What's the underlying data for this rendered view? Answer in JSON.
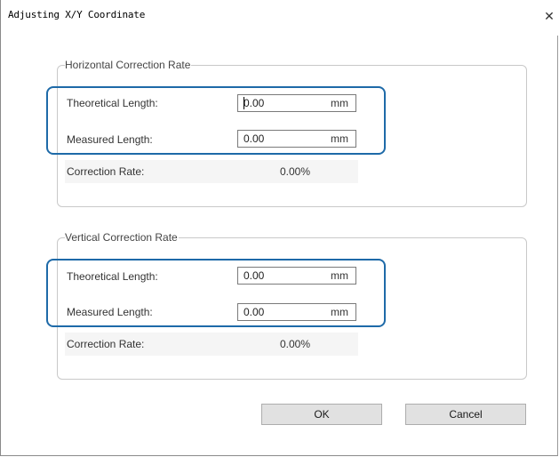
{
  "window": {
    "title": "Adjusting X/Y Coordinate",
    "close_glyph": "✕"
  },
  "horizontal": {
    "legend": "Horizontal Correction Rate",
    "theoretical_label": "Theoretical Length:",
    "theoretical_value": "0.00",
    "theoretical_unit": "mm",
    "measured_label": "Measured Length:",
    "measured_value": "0.00",
    "measured_unit": "mm",
    "rate_label": "Correction Rate:",
    "rate_value": "0.00%"
  },
  "vertical": {
    "legend": "Vertical Correction Rate",
    "theoretical_label": "Theoretical Length:",
    "theoretical_value": "0.00",
    "theoretical_unit": "mm",
    "measured_label": "Measured Length:",
    "measured_value": "0.00",
    "measured_unit": "mm",
    "rate_label": "Correction Rate:",
    "rate_value": "0.00%"
  },
  "buttons": {
    "ok_label": "OK",
    "cancel_label": "Cancel"
  },
  "colors": {
    "highlight": "#1e6aa8",
    "button_bg": "#e1e1e1"
  }
}
